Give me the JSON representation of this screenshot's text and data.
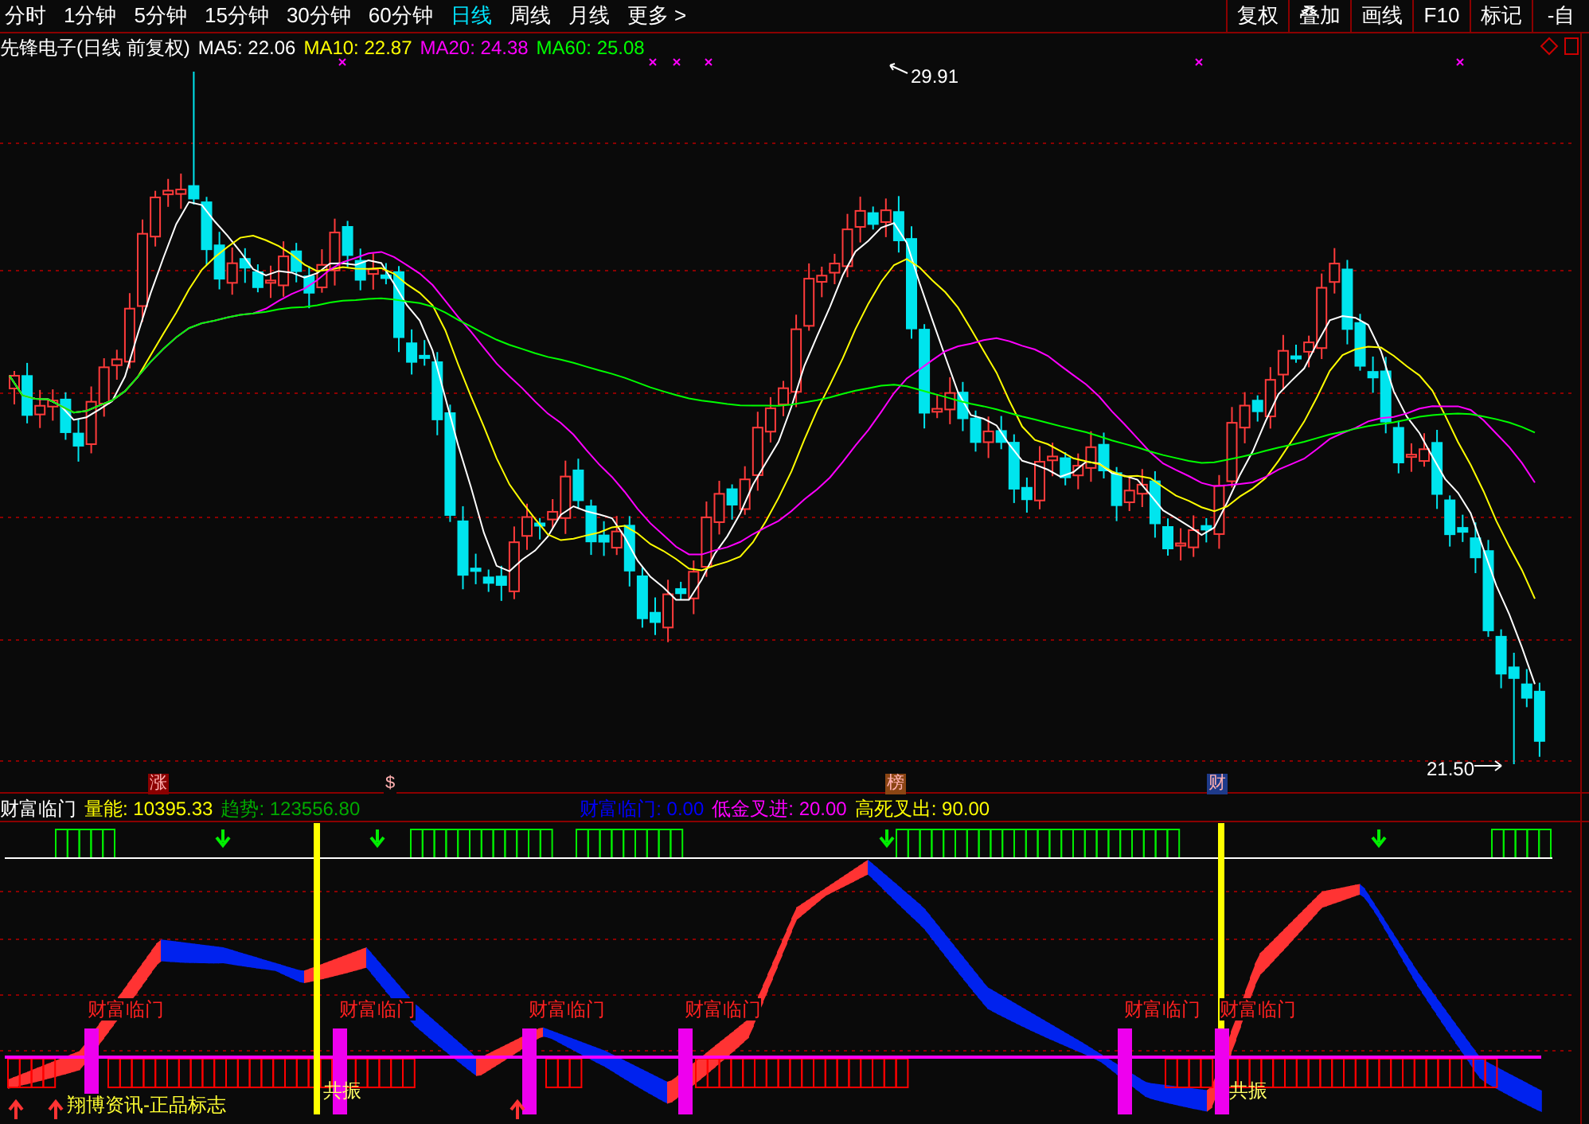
{
  "toolbar": {
    "periods": [
      {
        "label": "分时",
        "selected": false
      },
      {
        "label": "1分钟",
        "selected": false
      },
      {
        "label": "5分钟",
        "selected": false
      },
      {
        "label": "15分钟",
        "selected": false
      },
      {
        "label": "30分钟",
        "selected": false
      },
      {
        "label": "60分钟",
        "selected": false
      },
      {
        "label": "日线",
        "selected": true
      },
      {
        "label": "周线",
        "selected": false
      },
      {
        "label": "月线",
        "selected": false
      },
      {
        "label": "更多 >",
        "selected": false
      }
    ],
    "buttons": [
      "复权",
      "叠加",
      "画线",
      "F10",
      "标记",
      "-自"
    ]
  },
  "price_chart": {
    "title": "先锋电子(日线 前复权)",
    "moving_averages": [
      {
        "label": "MA5: 22.06",
        "color": "#ffffff"
      },
      {
        "label": "MA10: 22.87",
        "color": "#ffff00"
      },
      {
        "label": "MA20: 24.38",
        "color": "#ff00ff"
      },
      {
        "label": "MA60: 25.08",
        "color": "#00ff00"
      }
    ],
    "high_label": "29.91",
    "low_label": "21.50",
    "event_markers": [
      {
        "label": "涨",
        "color": "#8b0000"
      },
      {
        "label": "$",
        "color": "#0a0a0a"
      },
      {
        "label": "榜",
        "color": "#8b4513"
      },
      {
        "label": "财",
        "color": "#1e3a8a"
      }
    ]
  },
  "indicator": {
    "legend": [
      {
        "label": "财富临门",
        "color": "#ffffff"
      },
      {
        "label": "量能: 10395.33",
        "color": "#ffff00"
      },
      {
        "label": "趋势: 123556.80",
        "color": "#00aa00"
      },
      {
        "label": "财富临门: 0.00",
        "color": "#0000ff"
      },
      {
        "label": "低金叉进: 20.00",
        "color": "#ff00ff"
      },
      {
        "label": "高死叉出: 90.00",
        "color": "#ffff00"
      }
    ],
    "signals": [
      "财富临门",
      "财富临门",
      "财富临门",
      "财富临门",
      "财富临门",
      "财富临门"
    ],
    "resonance": [
      "共振",
      "共振"
    ],
    "brand": "翔博资讯-正品标志"
  }
}
